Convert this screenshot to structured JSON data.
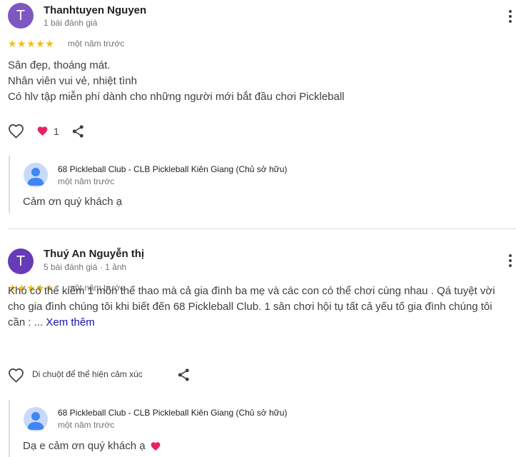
{
  "reviews": [
    {
      "avatar_letter": "T",
      "avatar_color": "#7e57c2",
      "name": "Thanhtuyen Nguyen",
      "meta": "1 bài đánh giá",
      "rating": 5,
      "stars": "★★★★★",
      "date": "một năm trước",
      "text": [
        "Sân đẹp, thoáng mát.",
        "Nhân viên vui vẻ, nhiệt tình",
        "Có hlv tập miễn phí dành cho những người mới bắt đầu chơi Pickleball"
      ],
      "reaction_count": "1",
      "reply": {
        "owner_name": "68 Pickleball Club - CLB Pickleball Kiên Giang (Chủ sở hữu)",
        "date": "một năm trước",
        "text": "Cảm ơn quý khách ạ"
      }
    },
    {
      "avatar_letter": "T",
      "avatar_color": "#673ab7",
      "name": "Thuý An Nguyễn thị",
      "meta": "5 bài đánh giá · 1 ảnh",
      "rating": 5,
      "stars": "★★★★★",
      "date": "một năm trước",
      "text_main": "Khó có thể kiếm 1 môn thể thao mà cả gia đình ba mẹ và các con có thể chơi cùng nhau . Qá tuyệt vời cho gia đình chúng tôi khi biết đến 68 Pickleball Club. 1 sân chơi hội tụ tất cả yếu tố gia đình chúng tôi cần : ...",
      "more_label": "Xem thêm",
      "hover_hint": "Di chuột để thể hiện cảm xúc",
      "reply": {
        "owner_name": "68 Pickleball Club - CLB Pickleball Kiên Giang (Chủ sở hữu)",
        "date": "một năm trước",
        "text": "Dạ e cảm ơn quý khách ạ"
      }
    }
  ],
  "colors": {
    "star": "#fbbc04",
    "heart_reaction": "#e91e63",
    "link": "#1a0dab",
    "owner_avatar_bg": "#c8dafa",
    "owner_avatar_fg": "#4285f4"
  },
  "icons": [
    "heart-outline-icon",
    "heart-filled-icon",
    "share-icon",
    "more-vert-icon",
    "owner-profile-icon"
  ]
}
